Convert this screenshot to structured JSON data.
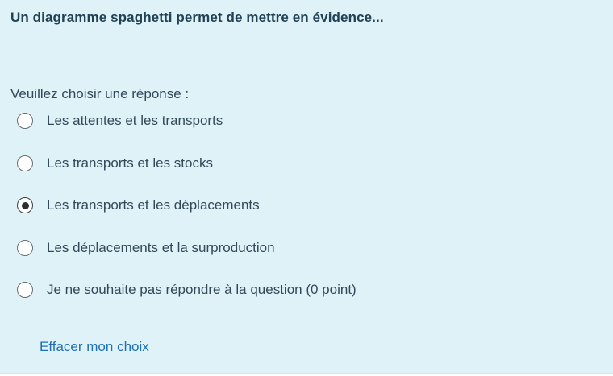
{
  "question": {
    "text": "Un diagramme spaghetti permet de mettre en évidence..."
  },
  "prompt": "Veuillez choisir une réponse :",
  "answers": [
    {
      "label": "Les attentes et les transports",
      "selected": false
    },
    {
      "label": "Les transports et les stocks",
      "selected": false
    },
    {
      "label": "Les transports et les déplacements",
      "selected": true
    },
    {
      "label": "Les déplacements et la surproduction",
      "selected": false
    },
    {
      "label": "Je ne souhaite pas répondre à la question (0 point)",
      "selected": false
    }
  ],
  "clear_choice_label": "Effacer mon choix",
  "colors": {
    "panel_background": "#def2f8",
    "question_text": "#214254",
    "body_text": "#33495a",
    "link": "#1f6fb5"
  }
}
